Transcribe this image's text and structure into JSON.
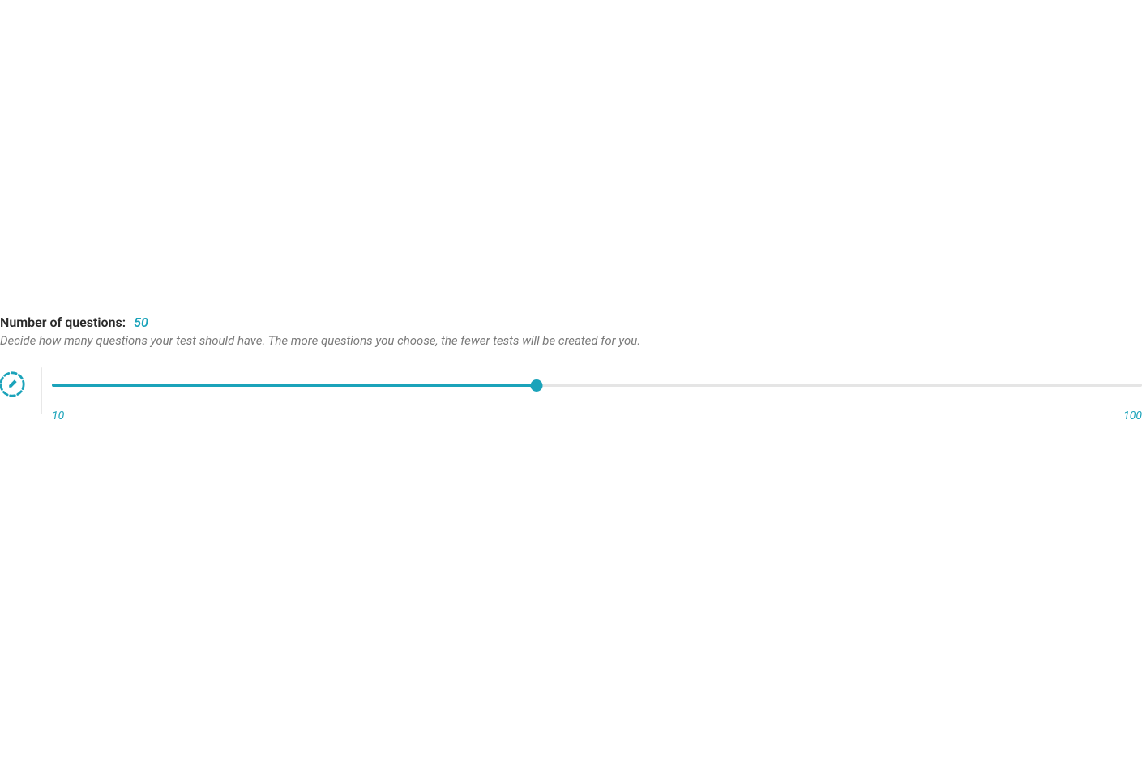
{
  "slider": {
    "heading_label": "Number of questions:",
    "current_value": "50",
    "description": "Decide how many questions your test should have. The more questions you choose, the fewer tests will be created for you.",
    "min_label": "10",
    "max_label": "100",
    "min": 10,
    "max": 100,
    "value": 50,
    "fill_percent": 44.44
  },
  "colors": {
    "accent": "#1ba3ba",
    "text_primary": "#2a2a2a",
    "text_muted": "#7a7a7a",
    "track_bg": "#e5e5e5"
  }
}
